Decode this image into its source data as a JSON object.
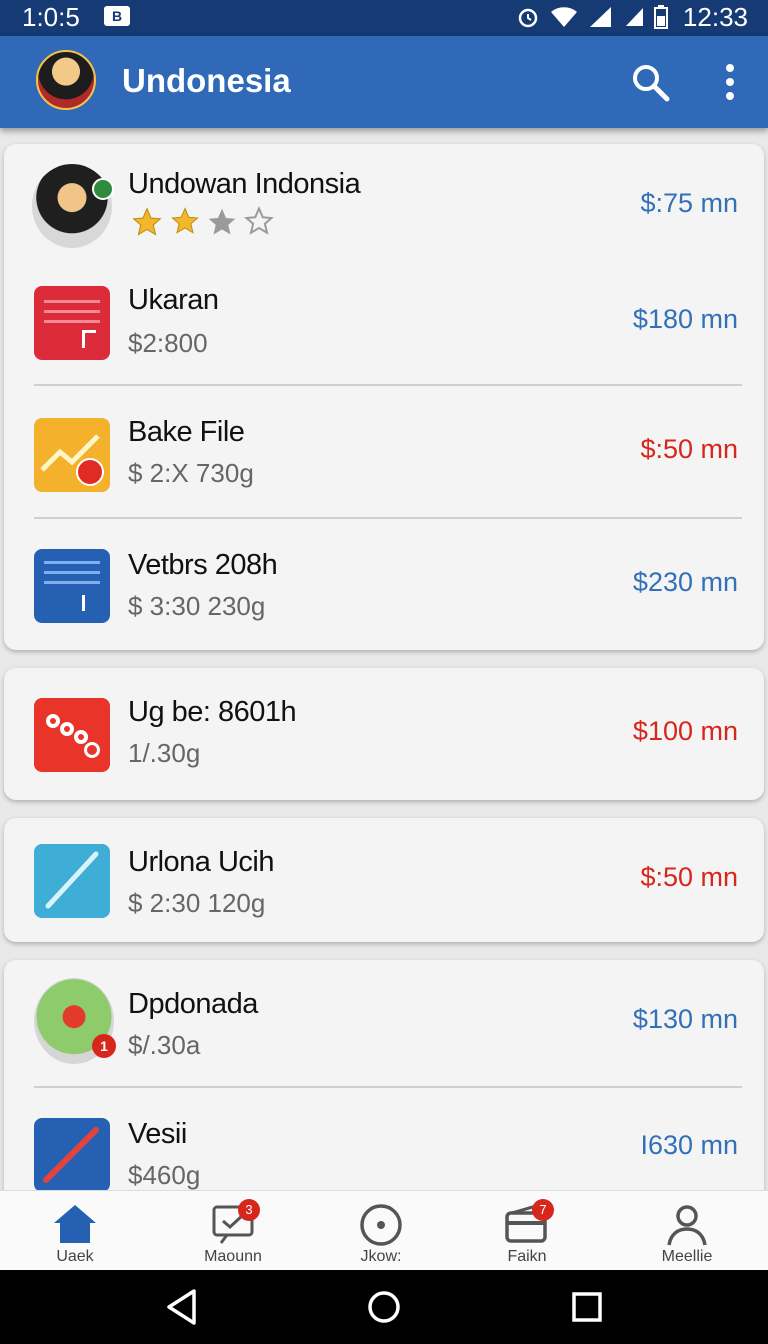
{
  "status_bar": {
    "time_left": "1:0:5",
    "time_right": "12:33",
    "notif_glyph": "B"
  },
  "app_bar": {
    "title": "Undonesia",
    "icons": [
      "search-icon",
      "more-vert-icon"
    ]
  },
  "items": [
    {
      "name": "Undowan Indonsia",
      "amount": "$:75 mn",
      "amount_color": "#3270b8",
      "rating": 2,
      "rating_max": 4,
      "icon": "avatar"
    },
    {
      "name": "Ukaran",
      "sub": "$2:800",
      "amount": "$180 mn",
      "amount_color": "#3270b8",
      "icon": "red-doc-icon"
    },
    {
      "name": "Bake File",
      "sub": "$ 2:X 730g",
      "amount": "$:50 mn",
      "amount_color": "#d7261c",
      "icon": "chart-icon"
    },
    {
      "name": "Vetbrs 208h",
      "sub": "$ 3:30 230g",
      "amount": "$230 mn",
      "amount_color": "#3270b8",
      "icon": "blue-doc-icon"
    },
    {
      "name": "Ug be: 8601h",
      "sub": "1/.30g",
      "amount": "$100 mn",
      "amount_color": "#d7261c",
      "icon": "gears-icon"
    },
    {
      "name": "Urlona Ucih",
      "sub": "$ 2:30 120g",
      "amount": "$:50 mn",
      "amount_color": "#d7261c",
      "icon": "pen-icon"
    },
    {
      "name": "Dpdonada",
      "sub": "$/.30a",
      "amount": "$130 mn",
      "amount_color": "#3270b8",
      "icon": "people-avatar",
      "badge": "1"
    },
    {
      "name": "Vesii",
      "sub": "$460g",
      "amount": "I630 mn",
      "amount_color": "#3270b8",
      "icon": "blue-pen-icon"
    }
  ],
  "bottom_nav": [
    {
      "label": "Uaek",
      "icon": "home-icon"
    },
    {
      "label": "Maounn",
      "icon": "message-check-icon",
      "badge": "3"
    },
    {
      "label": "Jkow:",
      "icon": "compass-icon"
    },
    {
      "label": "Faikn",
      "icon": "wallet-icon",
      "badge": "7"
    },
    {
      "label": "Meellie",
      "icon": "person-icon"
    }
  ],
  "colors": {
    "app_bar": "#2f69b7",
    "status_bar": "#163a73",
    "accent_blue": "#3270b8",
    "accent_red": "#d7261c"
  }
}
